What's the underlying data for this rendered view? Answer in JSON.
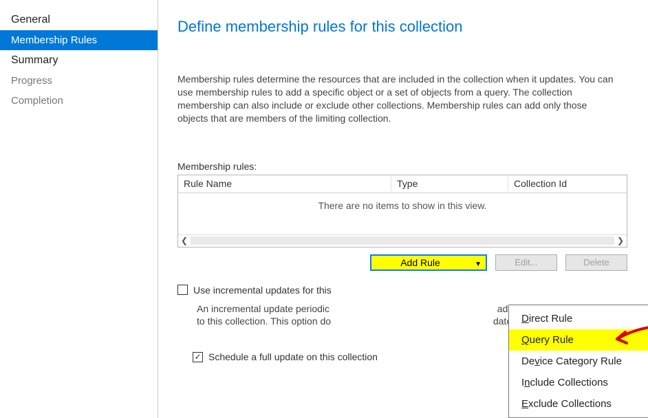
{
  "sidebar": {
    "items": [
      {
        "label": "General",
        "active": false,
        "kind": "heading"
      },
      {
        "label": "Membership Rules",
        "active": true,
        "kind": "normal"
      },
      {
        "label": "Summary",
        "active": false,
        "kind": "heading"
      },
      {
        "label": "Progress",
        "active": false,
        "kind": "sub"
      },
      {
        "label": "Completion",
        "active": false,
        "kind": "sub"
      }
    ]
  },
  "page": {
    "title": "Define membership rules for this collection",
    "intro": "Membership rules determine the resources that are included in the collection when it updates. You can use membership rules to add a specific object or a set of objects from a query. The collection membership can also include or exclude other collections. Membership rules can add only those objects that are members of the limiting collection."
  },
  "rules": {
    "section_label": "Membership rules:",
    "columns": {
      "name": "Rule Name",
      "type": "Type",
      "id": "Collection Id"
    },
    "empty_message": "There are no items to show in this view."
  },
  "buttons": {
    "add": "Add Rule",
    "edit": "Edit...",
    "delete": "Delete"
  },
  "dropdown": {
    "items": [
      {
        "label": "Direct Rule",
        "u": "D",
        "rest": "irect Rule",
        "highlight": false
      },
      {
        "label": "Query Rule",
        "u": "Q",
        "rest": "uery Rule",
        "highlight": true
      },
      {
        "label": "Device Category Rule",
        "u": "v",
        "pre": "De",
        "rest": "ice Category Rule",
        "highlight": false
      },
      {
        "label": "Include Collections",
        "u": "n",
        "pre": "I",
        "rest": "clude Collections",
        "highlight": false
      },
      {
        "label": "Exclude Collections",
        "u": "E",
        "rest": "xclude Collections",
        "highlight": false
      }
    ]
  },
  "incremental": {
    "check_label_visible": "Use incremental updates for this",
    "desc_left": "An incremental update periodic",
    "desc_right_top": "adds resources that qualify",
    "desc_right_bottom": "date for this collection.",
    "desc_left_2": "to this collection. This option do"
  },
  "schedule": {
    "check_label": "Schedule a full update on this collection"
  }
}
